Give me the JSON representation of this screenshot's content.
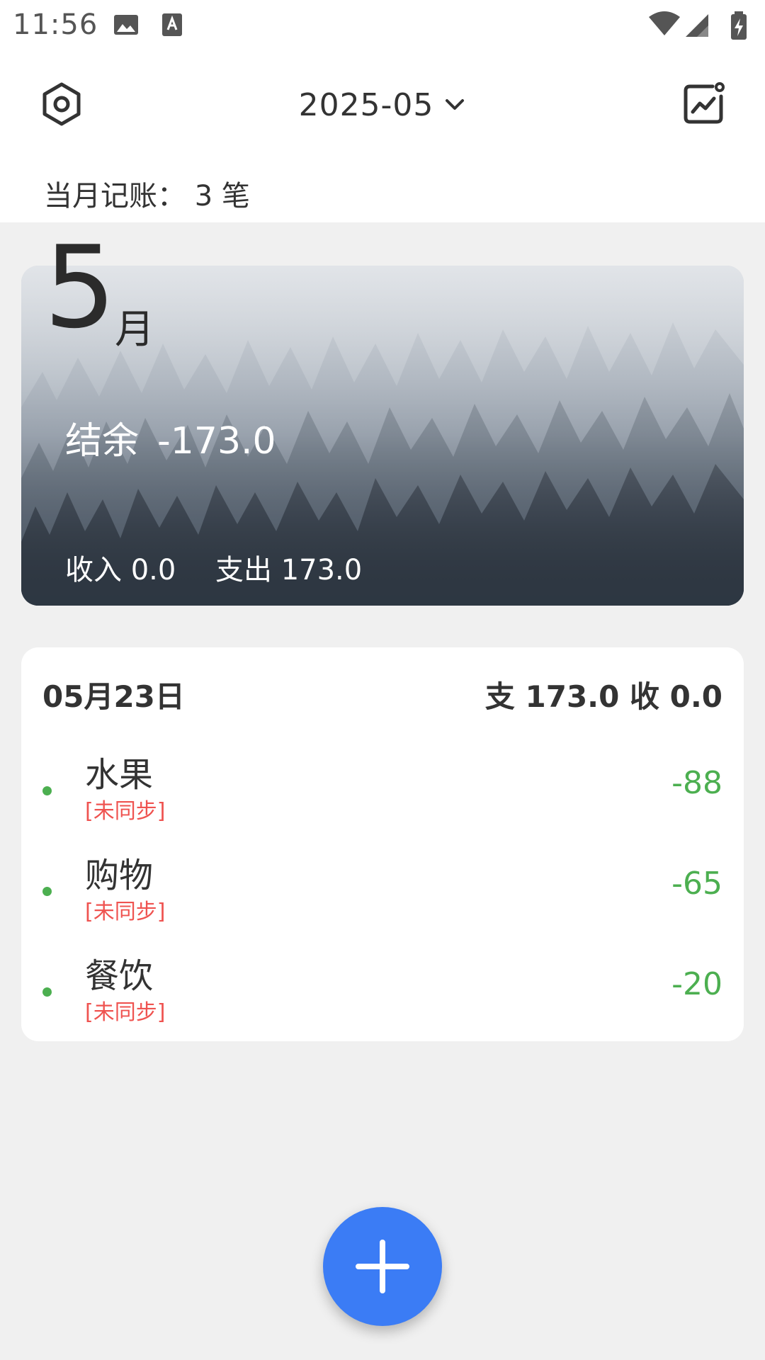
{
  "status_bar": {
    "time": "11:56",
    "icons": [
      "image-icon",
      "a-keyboard-icon",
      "wifi-icon",
      "signal-icon",
      "battery-charging-icon"
    ]
  },
  "header": {
    "month": "2025-05",
    "record_count": "当月记账： 3 笔"
  },
  "summary_card": {
    "month_number": "5",
    "month_unit": "月",
    "balance_label": "结余",
    "balance_value": "-173.0",
    "income_text": "收入 0.0",
    "expense_text": "支出 173.0"
  },
  "day_groups": [
    {
      "date": "05月23日",
      "summary": "支 173.0 收 0.0",
      "entries": [
        {
          "name": "水果",
          "status": "[未同步]",
          "amount": "-88"
        },
        {
          "name": "购物",
          "status": "[未同步]",
          "amount": "-65"
        },
        {
          "name": "餐饮",
          "status": "[未同步]",
          "amount": "-20"
        }
      ]
    }
  ],
  "colors": {
    "accent": "#3b7cf5",
    "amount_expense": "#4caf50",
    "unsynced": "#ef5350"
  }
}
